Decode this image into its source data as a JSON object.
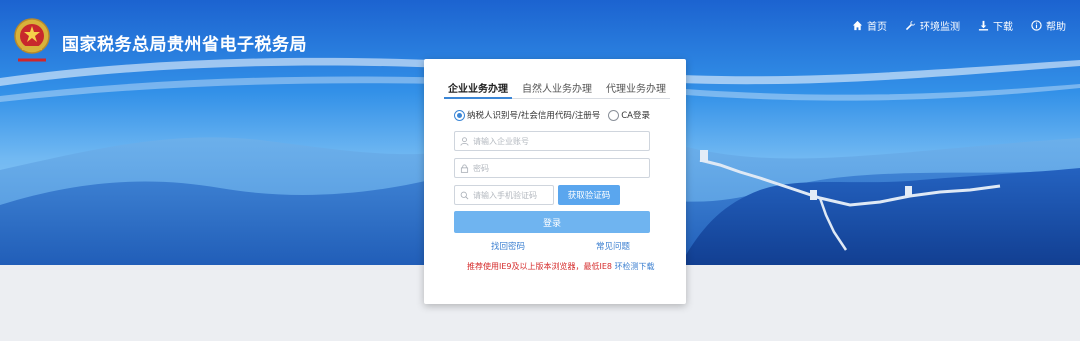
{
  "header": {
    "title": "国家税务总局贵州省电子税务局",
    "logo_icon": "tax-emblem-icon",
    "nav": [
      {
        "label": "首页",
        "icon": "home-icon"
      },
      {
        "label": "环境监测",
        "icon": "wrench-icon"
      },
      {
        "label": "下载",
        "icon": "download-icon"
      },
      {
        "label": "帮助",
        "icon": "info-icon"
      }
    ]
  },
  "login": {
    "tabs": [
      {
        "label": "企业业务办理",
        "active": true
      },
      {
        "label": "自然人业务办理",
        "active": false
      },
      {
        "label": "代理业务办理",
        "active": false
      }
    ],
    "radios": [
      {
        "label": "纳税人识别号/社会信用代码/注册号",
        "selected": true
      },
      {
        "label": "CA登录",
        "selected": false
      }
    ],
    "account_placeholder": "请输入企业账号",
    "password_placeholder": "密码",
    "sms_placeholder": "请输入手机验证码",
    "sms_button": "获取验证码",
    "login_button": "登录",
    "forgot_password": "找回密码",
    "faq": "常见问题",
    "notice_text": "推荐使用IE9及以上版本浏览器，最低IE8",
    "notice_link": "环检测下载"
  },
  "colors": {
    "accent": "#3b86d6",
    "button": "#6fb4f0",
    "notice": "#d52b2b",
    "link": "#3b7fd0"
  }
}
